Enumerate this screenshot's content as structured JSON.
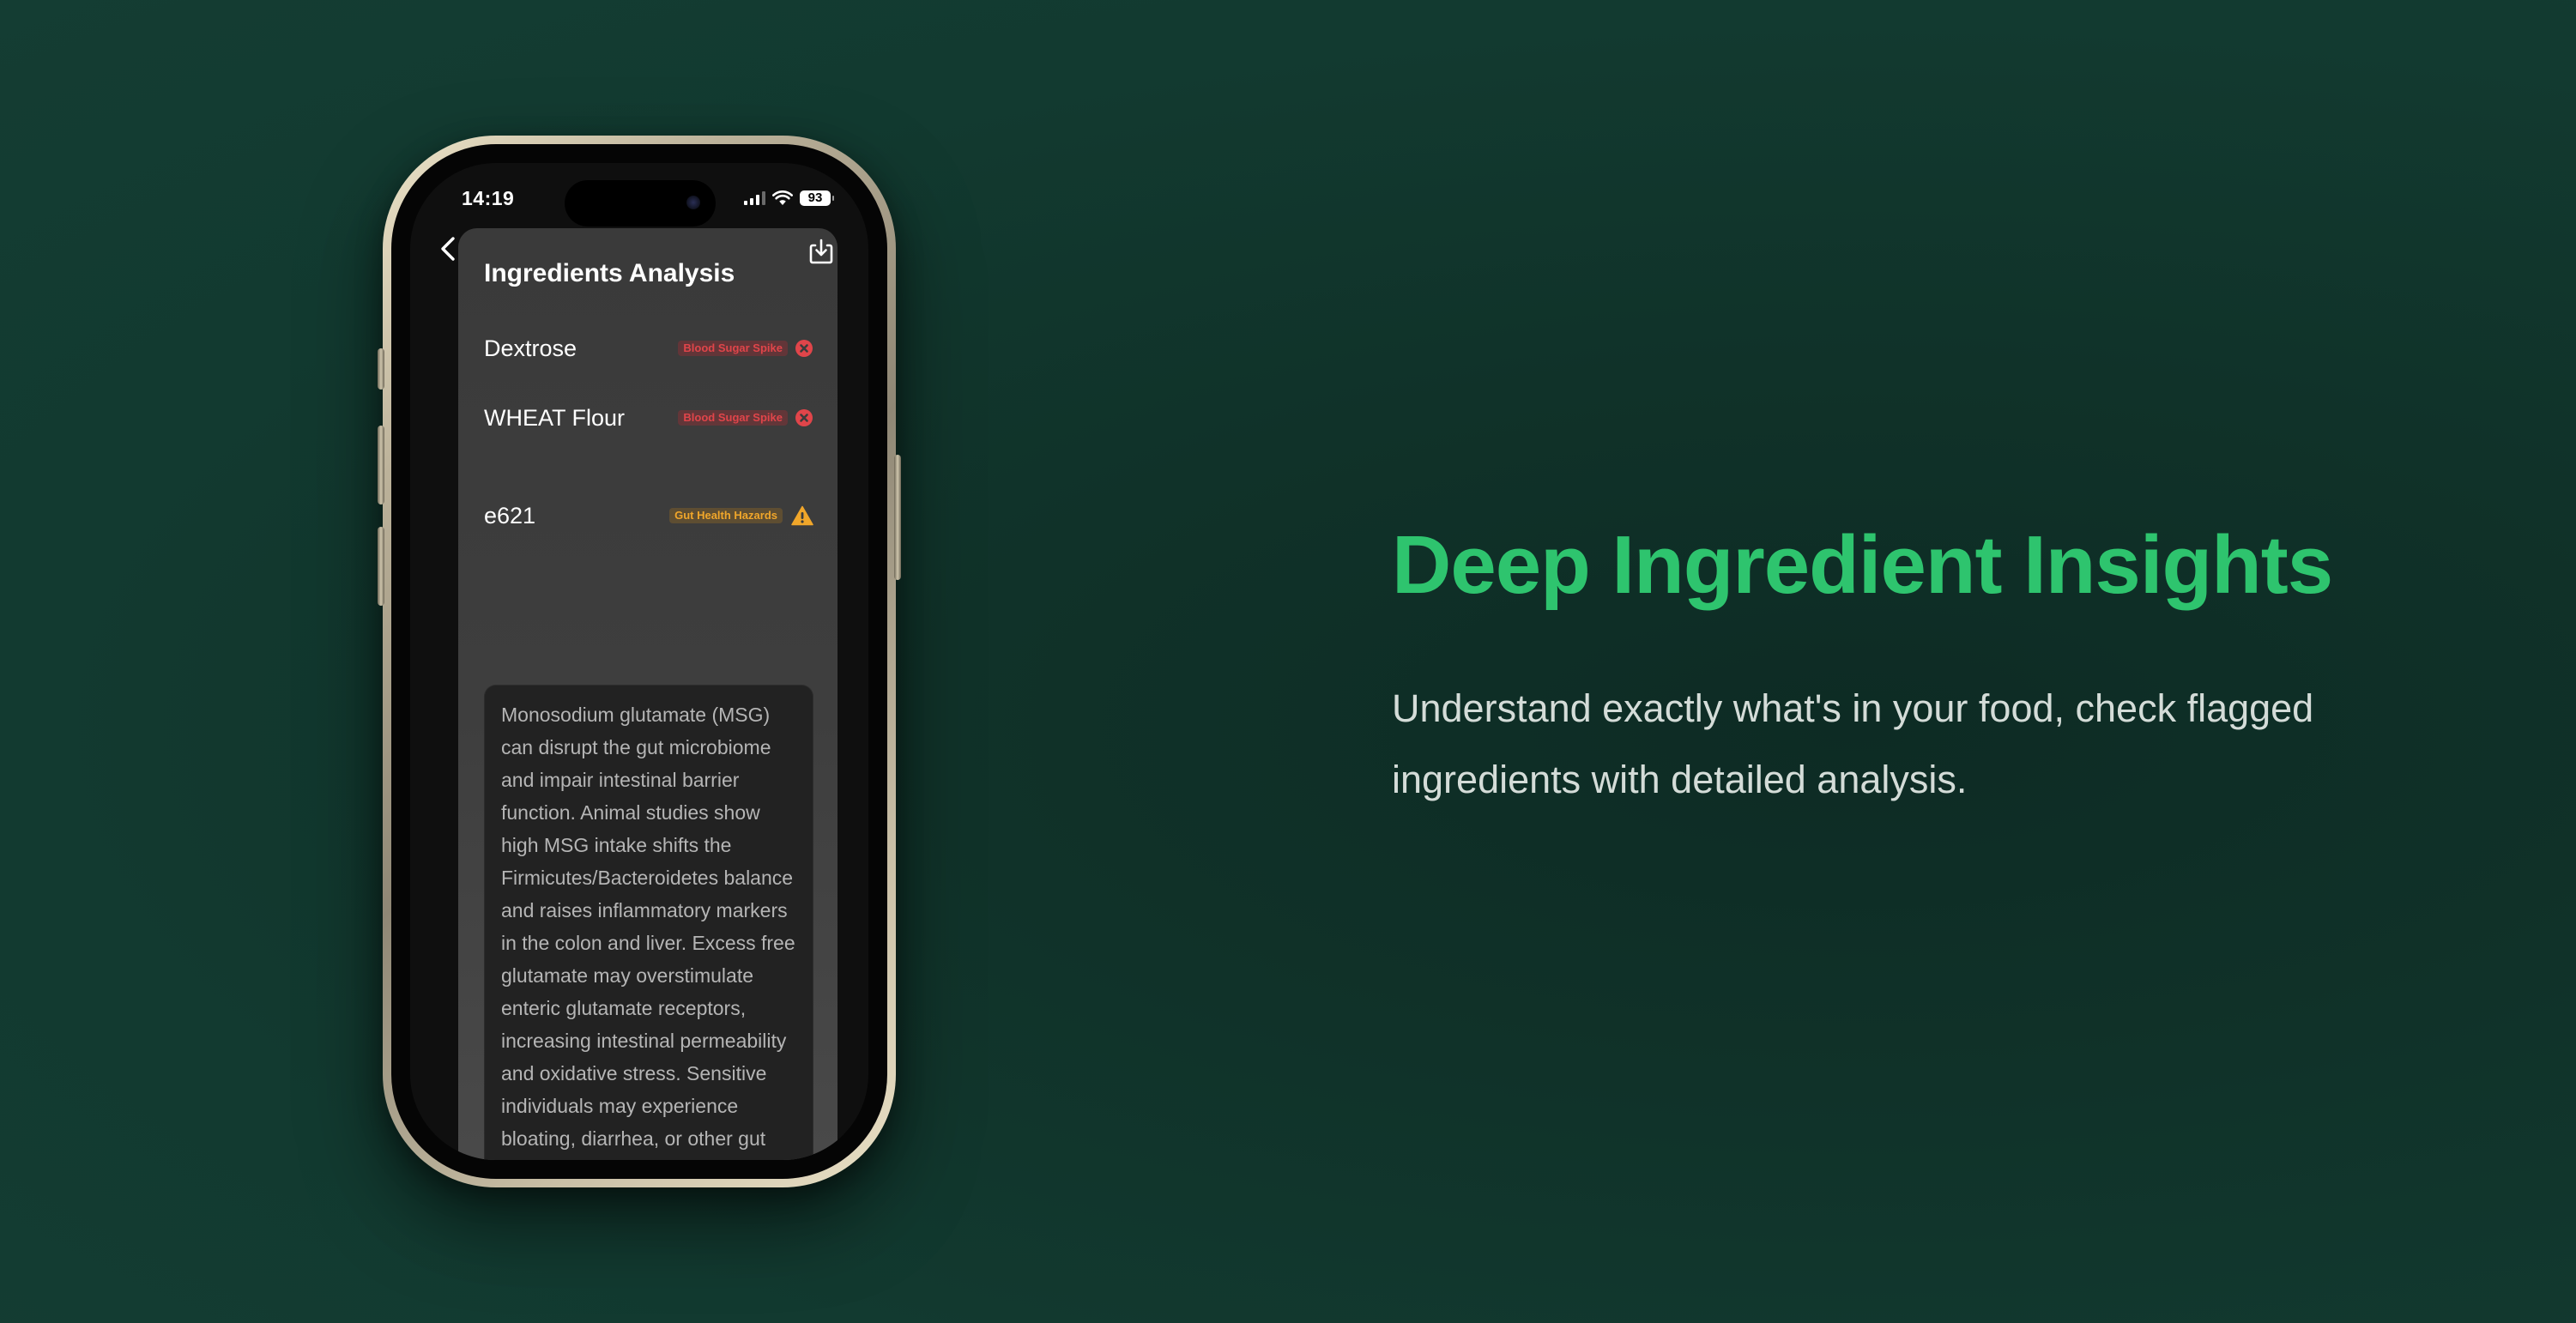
{
  "phone": {
    "status_bar": {
      "time": "14:19",
      "battery": "93"
    },
    "screen": {
      "title": "Ingredients Analysis",
      "ingredients": [
        {
          "name": "Dextrose",
          "tag": "Blood Sugar Spike",
          "severity_icon": "x-circle-icon"
        },
        {
          "name": "WHEAT Flour",
          "tag": "Blood Sugar Spike",
          "severity_icon": "x-circle-icon"
        },
        {
          "name": "e621",
          "tag": "Gut Health Hazards",
          "severity_icon": "warning-triangle-icon"
        }
      ],
      "description": "Monosodium glutamate (MSG) can disrupt the gut microbiome and impair intestinal barrier function. Animal studies show high MSG intake shifts the Firmicutes/Bacteroidetes balance and raises inflammatory markers in the colon and liver. Excess free glutamate may overstimulate enteric glutamate receptors, increasing intestinal permeability and oxidative stress. Sensitive individuals may experience bloating, diarrhea, or other gut symptoms after MSG consumption."
    }
  },
  "marketing": {
    "headline": "Deep Ingredient Insights",
    "subtext": "Understand exactly what's in your food, check flagged ingredients with detailed analysis."
  },
  "colors": {
    "accent_green": "#2ec46e",
    "tag_red": "#e0454a",
    "tag_orange": "#f0a62a",
    "background": "#123a30"
  }
}
